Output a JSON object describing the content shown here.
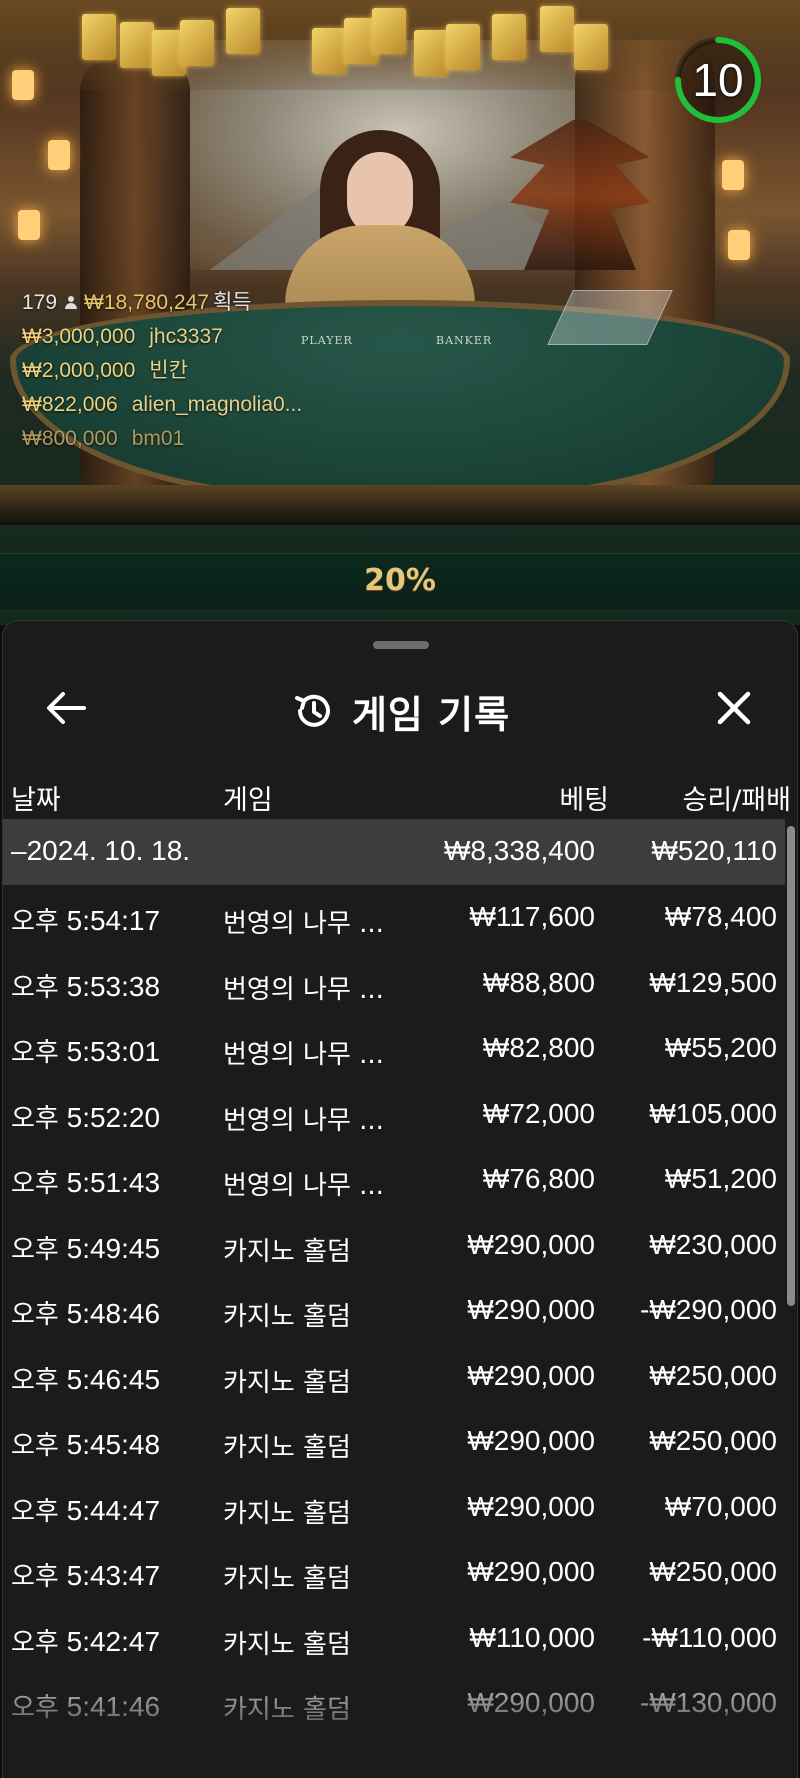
{
  "live": {
    "timer_value": "10",
    "timer_progress": 0.75,
    "table_labels": [
      "PLAYER",
      "BANKER"
    ],
    "winners_summary": {
      "count": "179",
      "amount": "₩18,780,247",
      "suffix": "획득"
    },
    "winners": [
      {
        "amount": "₩3,000,000",
        "name": "jhc3337"
      },
      {
        "amount": "₩2,000,000",
        "name": "빈칸"
      },
      {
        "amount": "₩822,006",
        "name": "alien_magnolia0..."
      },
      {
        "amount": "₩800,000",
        "name": "bm01"
      }
    ],
    "percent_banner": "20%"
  },
  "history": {
    "title": "게임 기록",
    "columns": {
      "date": "날짜",
      "game": "게임",
      "bet": "베팅",
      "win_loss": "승리/패배"
    },
    "group": {
      "date": "–2024. 10. 18.",
      "bet": "₩8,338,400",
      "win_loss": "₩520,110"
    },
    "rows": [
      {
        "ampm": "오후",
        "time": "5:54:17",
        "game": "번영의 나무 ...",
        "bet": "₩117,600",
        "win_loss": "₩78,400"
      },
      {
        "ampm": "오후",
        "time": "5:53:38",
        "game": "번영의 나무 ...",
        "bet": "₩88,800",
        "win_loss": "₩129,500"
      },
      {
        "ampm": "오후",
        "time": "5:53:01",
        "game": "번영의 나무 ...",
        "bet": "₩82,800",
        "win_loss": "₩55,200"
      },
      {
        "ampm": "오후",
        "time": "5:52:20",
        "game": "번영의 나무 ...",
        "bet": "₩72,000",
        "win_loss": "₩105,000"
      },
      {
        "ampm": "오후",
        "time": "5:51:43",
        "game": "번영의 나무 ...",
        "bet": "₩76,800",
        "win_loss": "₩51,200"
      },
      {
        "ampm": "오후",
        "time": "5:49:45",
        "game": "카지노 홀덤",
        "bet": "₩290,000",
        "win_loss": "₩230,000"
      },
      {
        "ampm": "오후",
        "time": "5:48:46",
        "game": "카지노 홀덤",
        "bet": "₩290,000",
        "win_loss": "-₩290,000"
      },
      {
        "ampm": "오후",
        "time": "5:46:45",
        "game": "카지노 홀덤",
        "bet": "₩290,000",
        "win_loss": "₩250,000"
      },
      {
        "ampm": "오후",
        "time": "5:45:48",
        "game": "카지노 홀덤",
        "bet": "₩290,000",
        "win_loss": "₩250,000"
      },
      {
        "ampm": "오후",
        "time": "5:44:47",
        "game": "카지노 홀덤",
        "bet": "₩290,000",
        "win_loss": "₩70,000"
      },
      {
        "ampm": "오후",
        "time": "5:43:47",
        "game": "카지노 홀덤",
        "bet": "₩290,000",
        "win_loss": "₩250,000"
      },
      {
        "ampm": "오후",
        "time": "5:42:47",
        "game": "카지노 홀덤",
        "bet": "₩110,000",
        "win_loss": "-₩110,000"
      },
      {
        "ampm": "오후",
        "time": "5:41:46",
        "game": "카지노 홀덤",
        "bet": "₩290,000",
        "win_loss": "-₩130,000"
      }
    ]
  },
  "icons": {
    "back": "arrow-left-icon",
    "history": "history-clock-icon",
    "close": "close-icon",
    "person": "person-icon"
  },
  "colors": {
    "sheet_bg": "#1b1b1b",
    "group_row_bg": "#3d3d3d",
    "gold": "#e6c86a",
    "timer_green": "#1fbf3a",
    "percent_gold": "#e9c47b"
  }
}
